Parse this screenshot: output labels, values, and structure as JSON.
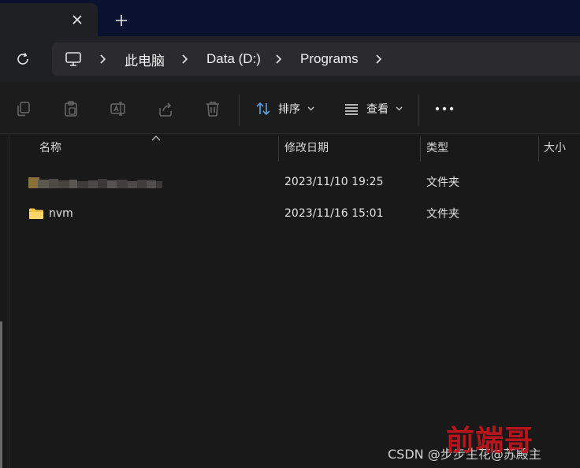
{
  "tabs": {
    "close_icon": "close-icon",
    "new_tab_icon": "plus-icon"
  },
  "address": {
    "refresh_icon": "refresh-icon",
    "root_icon": "computer-icon",
    "crumbs": [
      "此电脑",
      "Data (D:)",
      "Programs"
    ]
  },
  "toolbar": {
    "icons": [
      "copy-icon",
      "paste-icon",
      "rename-icon",
      "share-icon",
      "delete-icon"
    ],
    "sort_label": "排序",
    "view_label": "查看",
    "more_icon": "more-icon"
  },
  "columns": [
    "名称",
    "修改日期",
    "类型",
    "大小"
  ],
  "files": [
    {
      "name": "",
      "modified": "2023/11/10 19:25",
      "type": "文件夹",
      "name_obscured": true
    },
    {
      "name": "nvm",
      "modified": "2023/11/16 15:01",
      "type": "文件夹"
    }
  ],
  "watermark": {
    "csdn": "CSDN @步步生花@苏殿主",
    "seal": "前端哥"
  },
  "colors": {
    "folder": "#f2c24a",
    "tabstrip": "#0b1230",
    "seal": "#c4161c"
  }
}
